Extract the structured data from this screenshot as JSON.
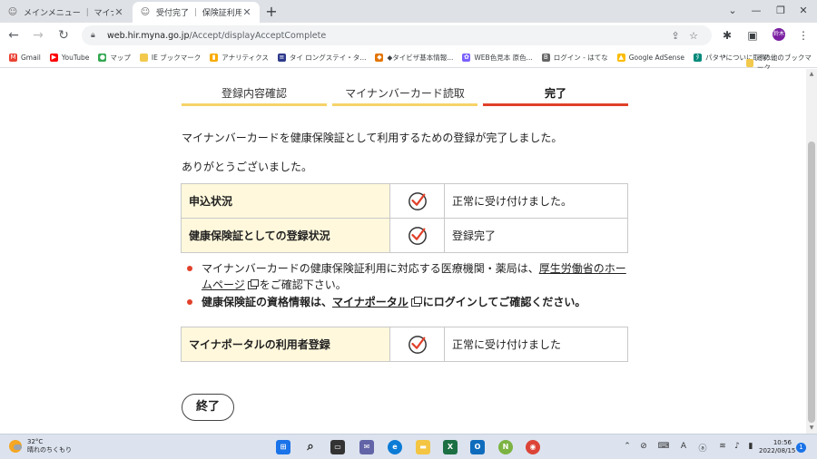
{
  "browser": {
    "tabs": [
      {
        "title": "メインメニュー ｜ マイナポータル",
        "active": false
      },
      {
        "title": "受付完了 ｜ 保険証利用受付シ",
        "active": true
      }
    ],
    "new_tab": "+",
    "url_host": "web.hir.myna.go.jp",
    "url_path": "/Accept/displayAcceptComplete",
    "avatar_text": "鈴木",
    "bookmarks": [
      {
        "label": "Gmail",
        "icon": "gmail-icon",
        "color": "#ea4335"
      },
      {
        "label": "YouTube",
        "icon": "youtube-icon",
        "color": "#ff0000"
      },
      {
        "label": "マップ",
        "icon": "maps-icon",
        "color": "#34a853"
      },
      {
        "label": "IE ブックマーク",
        "icon": "folder-icon",
        "color": "#f2c94c"
      },
      {
        "label": "アナリティクス",
        "icon": "analytics-icon",
        "color": "#f9ab00"
      },
      {
        "label": "タイ ロングステイ・タ...",
        "icon": "thai-flag-icon",
        "color": "#2d3a8c"
      },
      {
        "label": "◆タイビザ基本情報...",
        "icon": "bookmark-icon",
        "color": "#e37400"
      },
      {
        "label": "WEB色見本 原色...",
        "icon": "palette-icon",
        "color": "#7b61ff"
      },
      {
        "label": "ログイン - はてな",
        "icon": "hatena-icon",
        "color": "#666666"
      },
      {
        "label": "Google AdSense",
        "icon": "adsense-icon",
        "color": "#fbbc04"
      },
      {
        "label": "パタヤについに取得!...",
        "icon": "site-icon",
        "color": "#00897b"
      }
    ],
    "other_bookmarks": "その他のブックマーク"
  },
  "page": {
    "steps": [
      "登録内容確認",
      "マイナンバーカード読取",
      "完了"
    ],
    "message1": "マイナンバーカードを健康保険証として利用するための登録が完了しました。",
    "message2": "ありがとうございました。",
    "status_rows": [
      {
        "label": "申込状況",
        "value": "正常に受け付けました。"
      },
      {
        "label": "健康保険証としての登録状況",
        "value": "登録完了"
      }
    ],
    "notes": {
      "note1_text1": "マイナンバーカードの健康保険証利用に対応する医療機関・薬局は、",
      "note1_link": "厚生労働省のホームページ",
      "note1_text2": "をご確認下さい。",
      "note2_text1": "健康保険証の資格情報は、",
      "note2_link": "マイナポータル",
      "note2_text2": "にログインしてご確認ください。"
    },
    "portal_row": {
      "label": "マイナポータルの利用者登録",
      "value": "正常に受け付けました"
    },
    "end_button": "終了",
    "accent_color": "#e1402a",
    "step_color": "#f6d36a",
    "label_bg": "#fff8dc"
  },
  "taskbar": {
    "temperature": "32°C",
    "weather": "晴れのちくもり",
    "time": "10:56",
    "date": "2022/08/15",
    "notification_count": "1"
  }
}
